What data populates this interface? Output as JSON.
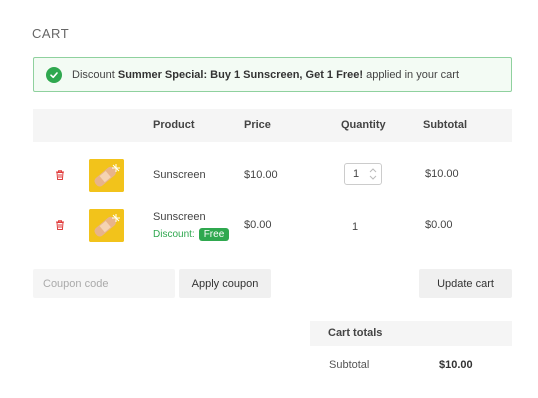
{
  "page": {
    "title": "CART"
  },
  "notice": {
    "prefix": "Discount",
    "discount_name": "Summer Special: Buy 1 Sunscreen, Get 1 Free!",
    "suffix": "applied in your cart",
    "color": "#2fa84f"
  },
  "table": {
    "headers": {
      "product": "Product",
      "price": "Price",
      "quantity": "Quantity",
      "subtotal": "Subtotal"
    },
    "rows": [
      {
        "product": "Sunscreen",
        "price": "$10.00",
        "quantity": "1",
        "subtotal": "$10.00",
        "remove_icon": "trash-icon"
      },
      {
        "product": "Sunscreen",
        "discount_label": "Discount:",
        "discount_badge": "Free",
        "price": "$0.00",
        "quantity": "1",
        "subtotal": "$0.00",
        "remove_icon": "trash-icon"
      }
    ]
  },
  "coupon": {
    "placeholder": "Coupon code",
    "apply_label": "Apply coupon"
  },
  "update_cart_label": "Update cart",
  "totals": {
    "title": "Cart totals",
    "subtotal_label": "Subtotal",
    "subtotal_value": "$10.00"
  },
  "colors": {
    "remove": "#e03b3b",
    "accent": "#2fa84f",
    "thumbnail": "#f2c31b"
  }
}
